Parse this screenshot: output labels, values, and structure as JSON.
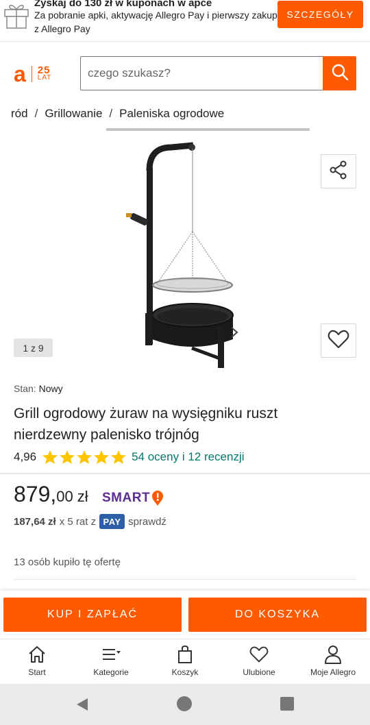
{
  "promo": {
    "title": "Zyskaj do 130 zł w kuponach w apce",
    "text": "Za pobranie apki, aktywację Allegro Pay i pierwszy zakup z Allegro Pay",
    "button_label": "SZCZEGÓŁY",
    "icon": "gift-icon"
  },
  "header": {
    "logo_letter": "a",
    "logo_anniversary_number": "25",
    "logo_anniversary_word": "LAT",
    "search_placeholder": "czego szukasz?",
    "search_icon": "search-icon"
  },
  "breadcrumb": {
    "items": [
      "ród",
      "Grillowanie",
      "Paleniska ogrodowe"
    ],
    "separator": "/"
  },
  "gallery": {
    "counter": "1 z 9",
    "share_icon": "share-icon",
    "favorite_icon": "heart-icon"
  },
  "product": {
    "condition_label": "Stan:",
    "condition_value": "Nowy",
    "title": "Grill ogrodowy żuraw na wysięgniku ruszt nierdzewny palenisko trójnóg",
    "rating_value": "4,96",
    "rating_stars": 5,
    "rating_link": "54 oceny i 12 recenzji",
    "price_int": "879,",
    "price_dec": "00",
    "price_currency": "zł",
    "smart_label": "SMART",
    "installment_amount": "187,64 zł",
    "installment_text": "x 5 rat z",
    "pay_badge": "PAY",
    "installment_link": "sprawdź",
    "bought_text": "13 osób kupiło tę ofertę"
  },
  "actions": {
    "buy_label": "KUP I ZAPŁAĆ",
    "cart_label": "DO KOSZYKA"
  },
  "bottom_nav": {
    "items": [
      {
        "label": "Start",
        "icon": "home-icon"
      },
      {
        "label": "Kategorie",
        "icon": "menu-icon"
      },
      {
        "label": "Koszyk",
        "icon": "bag-icon"
      },
      {
        "label": "Ulubione",
        "icon": "heart-icon"
      },
      {
        "label": "Moje Allegro",
        "icon": "user-icon"
      }
    ]
  },
  "colors": {
    "accent": "#ff5a00",
    "rating_star": "#ffc400",
    "link_green": "#00776b",
    "smart_purple": "#5c2d91",
    "pay_blue": "#2d5ea8"
  }
}
